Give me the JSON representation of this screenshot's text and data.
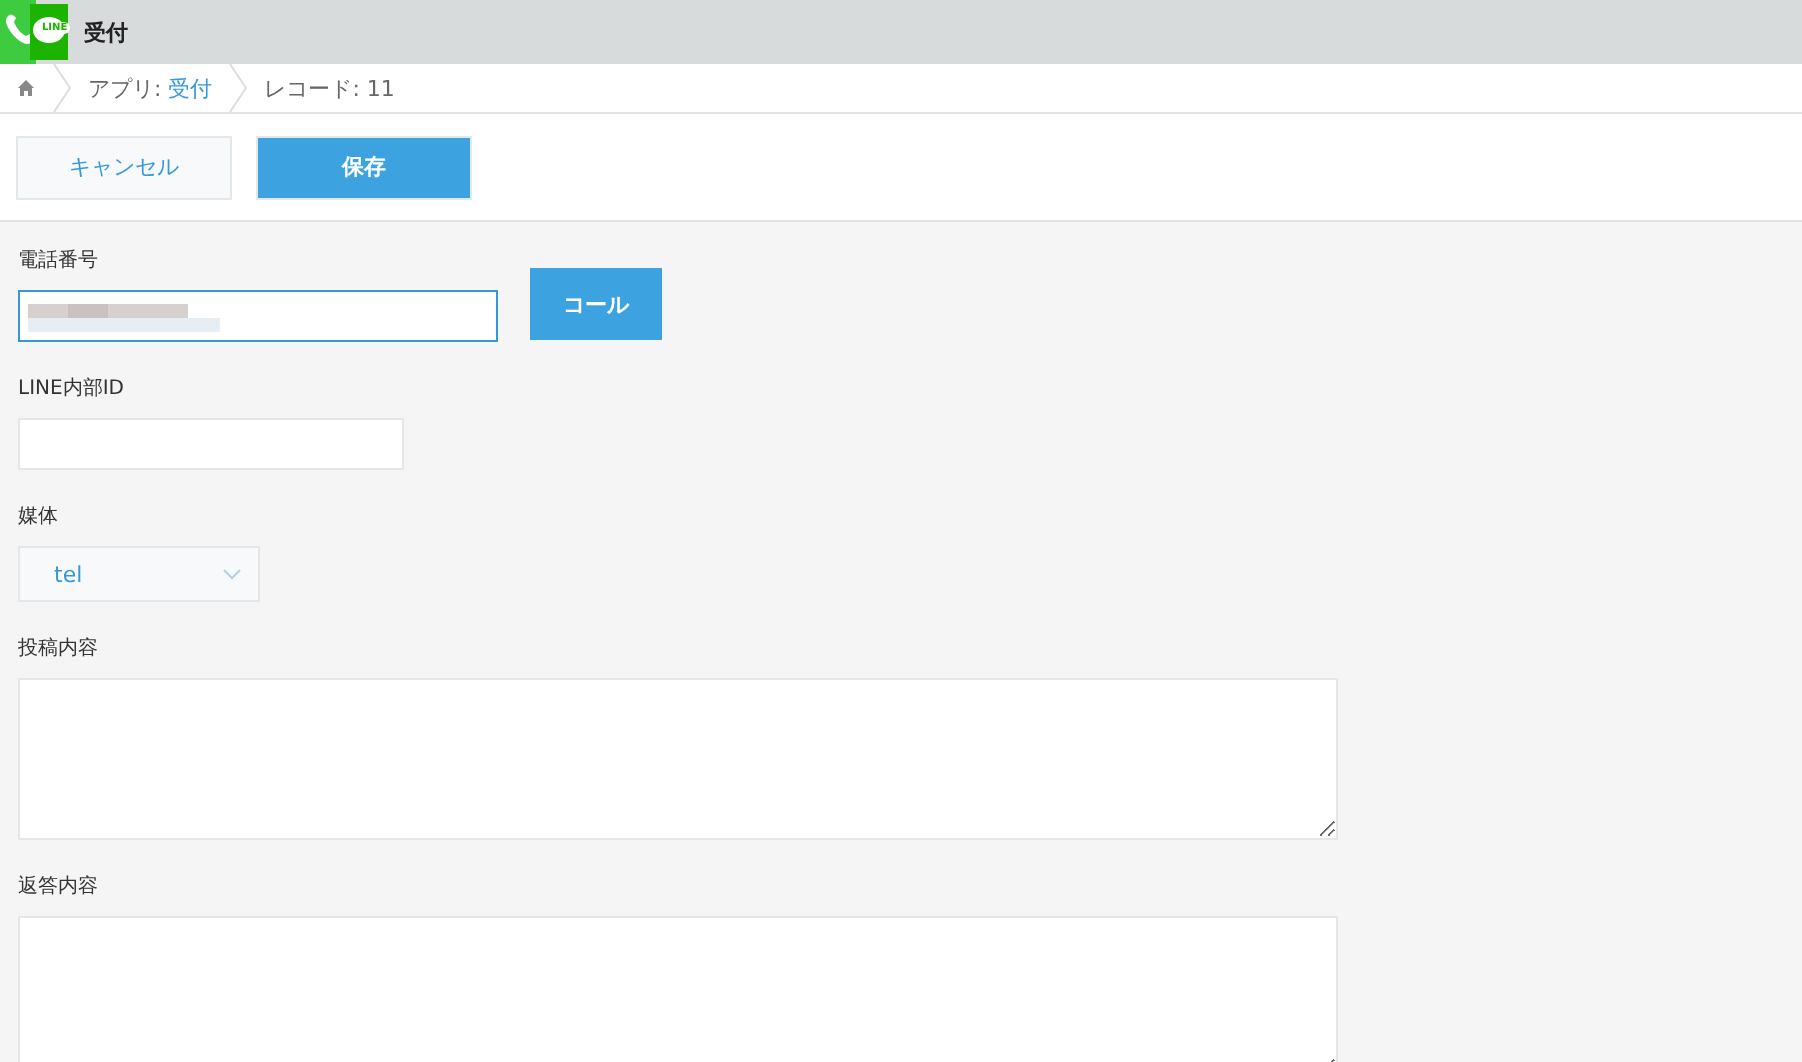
{
  "header": {
    "logo_text": "LINE",
    "title": "受付"
  },
  "breadcrumb": [
    {
      "kind": "home"
    },
    {
      "kind": "link",
      "prefix": "アプリ: ",
      "label": "受付"
    },
    {
      "kind": "text",
      "label": "レコード: 11"
    }
  ],
  "toolbar": {
    "cancel": "キャンセル",
    "save": "保存"
  },
  "fields": [
    {
      "kind": "phone",
      "label": "電話番号",
      "button": "コール",
      "focused": true
    },
    {
      "kind": "text",
      "label": "LINE内部ID"
    },
    {
      "kind": "select",
      "label": "媒体",
      "value": "tel"
    },
    {
      "kind": "textarea",
      "label": "投稿内容"
    },
    {
      "kind": "textarea",
      "label": "返答内容"
    }
  ]
}
